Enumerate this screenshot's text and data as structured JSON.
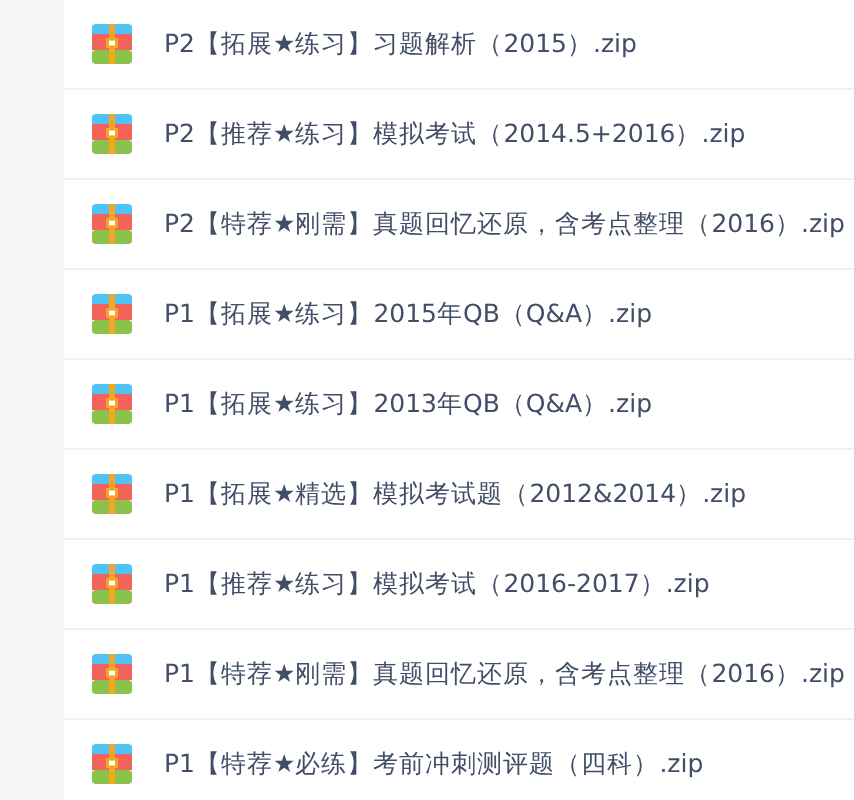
{
  "files": [
    {
      "name": "P2【拓展★练习】习题解析（2015）.zip"
    },
    {
      "name": "P2【推荐★练习】模拟考试（2014.5+2016）.zip"
    },
    {
      "name": "P2【特荐★刚需】真题回忆还原，含考点整理（2016）.zip"
    },
    {
      "name": "P1【拓展★练习】2015年QB（Q&A）.zip"
    },
    {
      "name": "P1【拓展★练习】2013年QB（Q&A）.zip"
    },
    {
      "name": "P1【拓展★精选】模拟考试题（2012&2014）.zip"
    },
    {
      "name": "P1【推荐★练习】模拟考试（2016-2017）.zip"
    },
    {
      "name": "P1【特荐★刚需】真题回忆还原，含考点整理（2016）.zip"
    },
    {
      "name": "P1【特荐★必练】考前冲刺测评题（四科）.zip"
    }
  ]
}
